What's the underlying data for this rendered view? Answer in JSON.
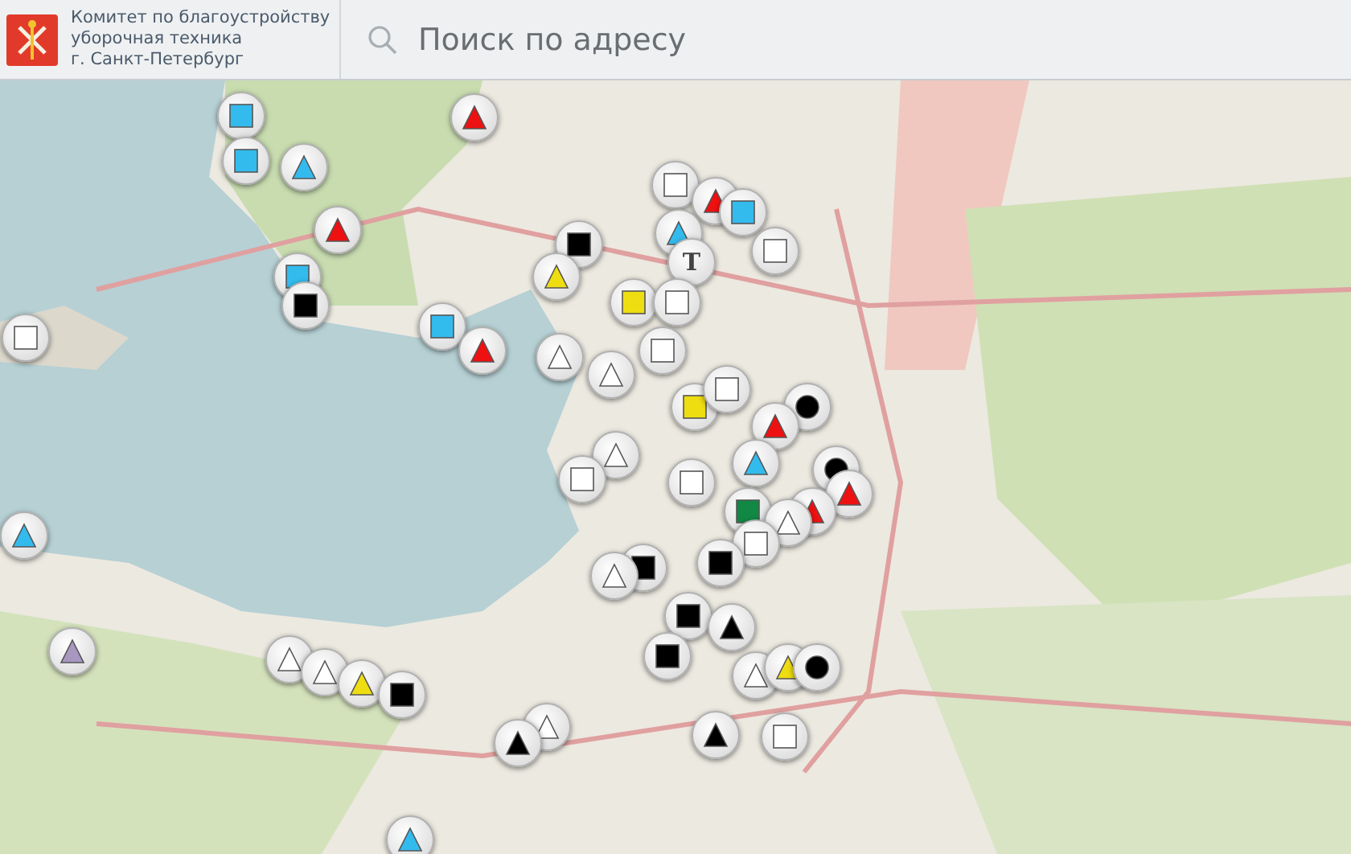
{
  "header": {
    "title_lines": [
      "Комитет по благоустройству",
      "уборочная техника",
      "г. Санкт-Петербург"
    ]
  },
  "search": {
    "placeholder": "Поиск по адресу"
  },
  "markers": [
    {
      "kind": "square",
      "color": "#33bbee"
    },
    {
      "kind": "square",
      "color": "#33bbee"
    },
    {
      "kind": "triangle",
      "color": "#33bbee"
    },
    {
      "kind": "triangle",
      "color": "#ee1111"
    },
    {
      "kind": "triangle",
      "color": "#ee1111"
    },
    {
      "kind": "square",
      "color": "#33bbee"
    },
    {
      "kind": "square",
      "color": "#000000"
    },
    {
      "kind": "square",
      "color": "#ffffff"
    },
    {
      "kind": "square",
      "color": "#33bbee"
    },
    {
      "kind": "triangle",
      "color": "#ee1111"
    },
    {
      "kind": "triangle",
      "color": "#ffffff"
    },
    {
      "kind": "square",
      "color": "#000000"
    },
    {
      "kind": "triangle",
      "color": "#eedd11"
    },
    {
      "kind": "square",
      "color": "#ffffff"
    },
    {
      "kind": "triangle",
      "color": "#ee1111"
    },
    {
      "kind": "square",
      "color": "#33bbee"
    },
    {
      "kind": "triangle",
      "color": "#33bbee"
    },
    {
      "kind": "letter",
      "label": "T"
    },
    {
      "kind": "square",
      "color": "#ffffff"
    },
    {
      "kind": "square",
      "color": "#eedd11"
    },
    {
      "kind": "square",
      "color": "#ffffff"
    },
    {
      "kind": "square",
      "color": "#ffffff"
    },
    {
      "kind": "triangle",
      "color": "#ffffff"
    },
    {
      "kind": "square",
      "color": "#eedd11"
    },
    {
      "kind": "square",
      "color": "#ffffff"
    },
    {
      "kind": "circle",
      "color": "#000000"
    },
    {
      "kind": "triangle",
      "color": "#ee1111"
    },
    {
      "kind": "triangle",
      "color": "#ffffff"
    },
    {
      "kind": "square",
      "color": "#ffffff"
    },
    {
      "kind": "circle",
      "color": "#000000"
    },
    {
      "kind": "triangle",
      "color": "#ee1111"
    },
    {
      "kind": "triangle",
      "color": "#33bbee"
    },
    {
      "kind": "square",
      "color": "#ffffff"
    },
    {
      "kind": "square",
      "color": "#118844"
    },
    {
      "kind": "triangle",
      "color": "#ee1111"
    },
    {
      "kind": "triangle",
      "color": "#ffffff"
    },
    {
      "kind": "square",
      "color": "#ffffff"
    },
    {
      "kind": "square",
      "color": "#000000"
    },
    {
      "kind": "square",
      "color": "#000000"
    },
    {
      "kind": "triangle",
      "color": "#ffffff"
    },
    {
      "kind": "square",
      "color": "#000000"
    },
    {
      "kind": "triangle",
      "color": "#000000"
    },
    {
      "kind": "square",
      "color": "#000000"
    },
    {
      "kind": "triangle",
      "color": "#ffffff"
    },
    {
      "kind": "triangle",
      "color": "#eedd11"
    },
    {
      "kind": "circle",
      "color": "#000000"
    },
    {
      "kind": "triangle",
      "color": "#ffffff"
    },
    {
      "kind": "triangle",
      "color": "#ffffff"
    },
    {
      "kind": "triangle",
      "color": "#eedd11"
    },
    {
      "kind": "square",
      "color": "#000000"
    },
    {
      "kind": "triangle",
      "color": "#ffffff"
    },
    {
      "kind": "triangle",
      "color": "#000000"
    },
    {
      "kind": "triangle",
      "color": "#000000"
    },
    {
      "kind": "square",
      "color": "#ffffff"
    },
    {
      "kind": "triangle",
      "color": "#33bbee"
    },
    {
      "kind": "triangle",
      "color": "#a898c0"
    },
    {
      "kind": "triangle",
      "color": "#33bbee"
    }
  ]
}
